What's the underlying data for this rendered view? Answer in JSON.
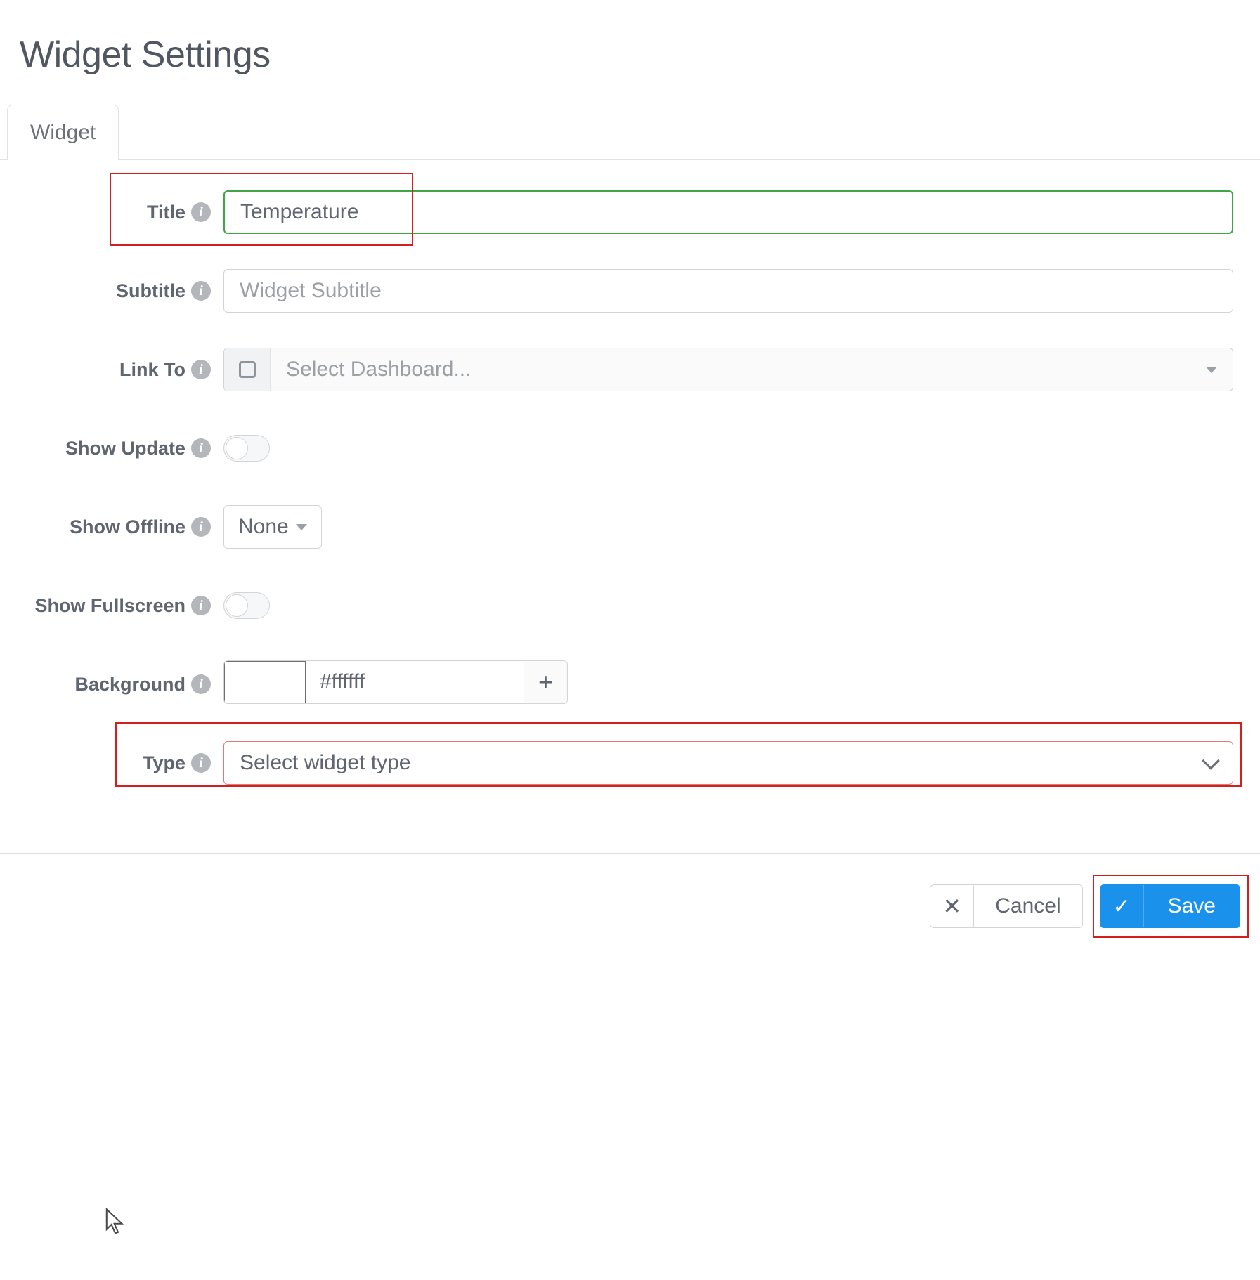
{
  "header": {
    "title": "Widget Settings"
  },
  "tabs": {
    "active": "Widget"
  },
  "form": {
    "title": {
      "label": "Title",
      "value": "Temperature"
    },
    "subtitle": {
      "label": "Subtitle",
      "placeholder": "Widget Subtitle",
      "value": ""
    },
    "linkto": {
      "label": "Link To",
      "placeholder": "Select Dashboard...",
      "checked": false
    },
    "show_update": {
      "label": "Show Update",
      "value": false
    },
    "show_offline": {
      "label": "Show Offline",
      "value": "None"
    },
    "show_fullscreen": {
      "label": "Show Fullscreen",
      "value": false
    },
    "background": {
      "label": "Background",
      "value": "#ffffff"
    },
    "type": {
      "label": "Type",
      "placeholder": "Select widget type"
    }
  },
  "footer": {
    "cancel": "Cancel",
    "save": "Save"
  }
}
